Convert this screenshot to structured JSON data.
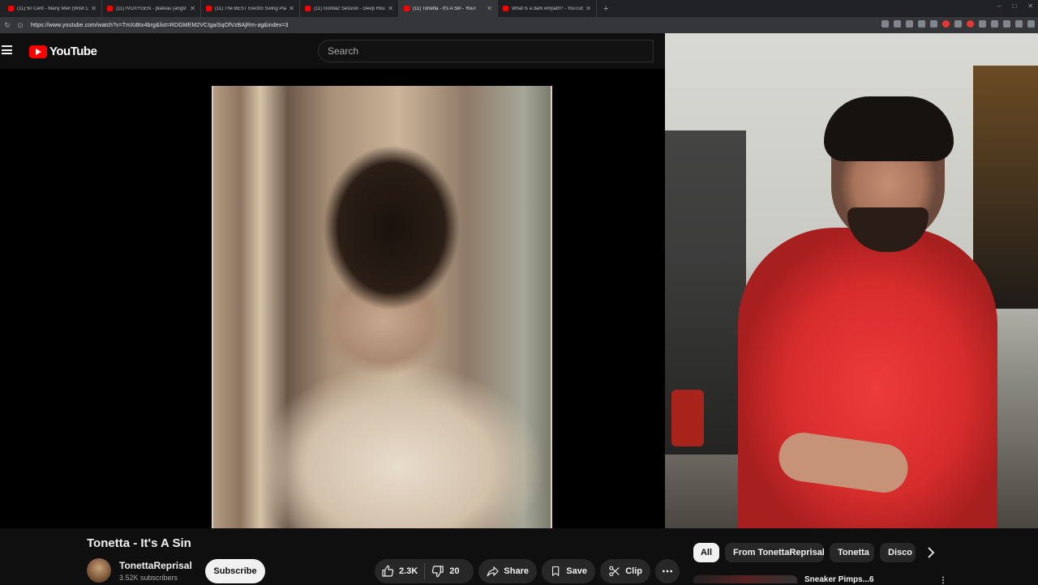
{
  "browser": {
    "tabs": [
      {
        "label": "(11) 50 Cent - Many Men (Wish D"
      },
      {
        "label": "(11) IVOXYGEN - plateau (angst T"
      },
      {
        "label": "(11) The BEST Electro Swing Playli"
      },
      {
        "label": "(11) Gorillaz Session - Deep House"
      },
      {
        "label": "(11) Tonetta - It's A Sin - YouT",
        "active": true
      },
      {
        "label": "What is a dark empath? - YouTube"
      }
    ],
    "new_tab": "+",
    "url": "https://www.youtube.com/watch?v=TmXdttx4brg&list=RDGMEM2VCIgaiSqOfVzBAjRm-ag&index=3"
  },
  "youtube": {
    "logo_text": "YouTube",
    "search_placeholder": "Search"
  },
  "video": {
    "title": "Tonetta - It's A Sin",
    "channel": "TonettaReprisal",
    "subscribers": "3.52K subscribers",
    "subscribe_label": "Subscribe",
    "likes": "2.3K",
    "dislikes": "20",
    "share_label": "Share",
    "save_label": "Save",
    "clip_label": "Clip"
  },
  "chips": [
    "All",
    "From TonettaReprisal",
    "Tonetta",
    "Disco"
  ],
  "recommendation": {
    "title": "Sneaker Pimps...6"
  },
  "colors": {
    "youtube_red": "#ff0000",
    "background": "#0f0f0f",
    "pill": "#272727",
    "shirt_red": "#e63232"
  }
}
